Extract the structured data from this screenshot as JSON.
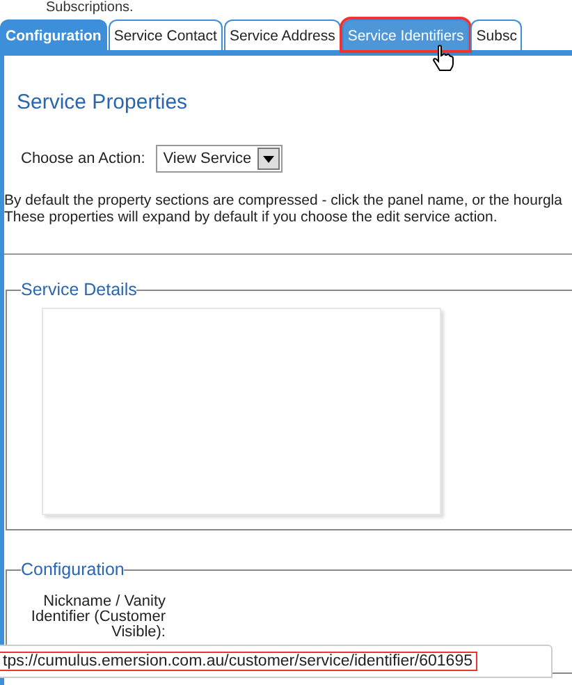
{
  "top_text": "Subscriptions.",
  "tabs": [
    {
      "label": "Configuration",
      "selected": true,
      "hovered": false,
      "highlighted": false
    },
    {
      "label": "Service Contact",
      "selected": false,
      "hovered": false,
      "highlighted": false
    },
    {
      "label": "Service Address",
      "selected": false,
      "hovered": false,
      "highlighted": false
    },
    {
      "label": "Service Identifiers",
      "selected": false,
      "hovered": true,
      "highlighted": true
    },
    {
      "label": "Subsc",
      "selected": false,
      "hovered": false,
      "highlighted": false
    }
  ],
  "heading": "Service Properties",
  "action": {
    "label": "Choose an Action:",
    "value": "View Service"
  },
  "description": [
    "By default the property sections are compressed - click the panel name, or the hourgla",
    "These properties will expand by default if you choose the edit service action."
  ],
  "sections": [
    {
      "legend": "Service Details",
      "kind": "card"
    },
    {
      "legend": "Configuration",
      "kind": "fields",
      "fields": [
        {
          "label": "Nickname / Vanity Identifier (Customer Visible):"
        }
      ]
    }
  ],
  "status_bar": {
    "url": "tps://cumulus.emersion.com.au/customer/service/identifier/601695",
    "highlighted": true
  }
}
